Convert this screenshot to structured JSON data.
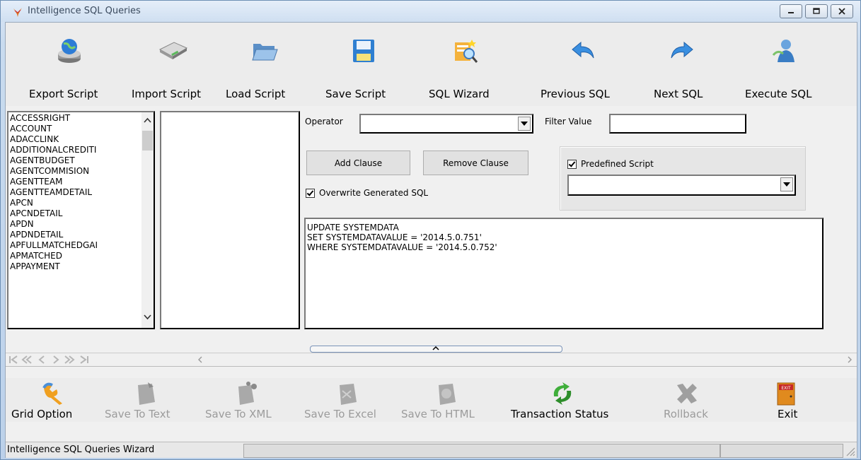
{
  "window": {
    "title": "Intelligence SQL Queries"
  },
  "toolbar": {
    "export_script": "Export Script",
    "import_script": "Import Script",
    "load_script": "Load Script",
    "save_script": "Save Script",
    "sql_wizard": "SQL Wizard",
    "previous_sql": "Previous SQL",
    "next_sql": "Next SQL",
    "execute_sql": "Execute SQL"
  },
  "tables": [
    "ACCESSRIGHT",
    "ACCOUNT",
    "ADACCLINK",
    "ADDITIONALCREDITI",
    "AGENTBUDGET",
    "AGENTCOMMISION",
    "AGENTTEAM",
    "AGENTTEAMDETAIL",
    "APCN",
    "APCNDETAIL",
    "APDN",
    "APDNDETAIL",
    "APFULLMATCHEDGAI",
    "APMATCHED",
    "APPAYMENT"
  ],
  "filter": {
    "operator_label": "Operator",
    "operator_value": "",
    "filter_value_label": "Filter Value",
    "filter_value": "",
    "add_clause": "Add Clause",
    "remove_clause": "Remove Clause",
    "overwrite_label": "Overwrite Generated SQL",
    "overwrite_checked": true,
    "predefined_label": "Predefined Script",
    "predefined_checked": true,
    "predefined_value": ""
  },
  "sql": {
    "line1": "UPDATE SYSTEMDATA",
    "line2": "SET SYSTEMDATAVALUE = '2014.5.0.751'",
    "line3": "WHERE SYSTEMDATAVALUE = '2014.5.0.752'"
  },
  "bottom": {
    "grid_option": "Grid Option",
    "save_text": "Save To Text",
    "save_xml": "Save To XML",
    "save_excel": "Save To Excel",
    "save_html": "Save To HTML",
    "transaction_status": "Transaction Status",
    "rollback": "Rollback",
    "exit": "Exit"
  },
  "status": {
    "text": "Intelligence SQL Queries Wizard"
  }
}
